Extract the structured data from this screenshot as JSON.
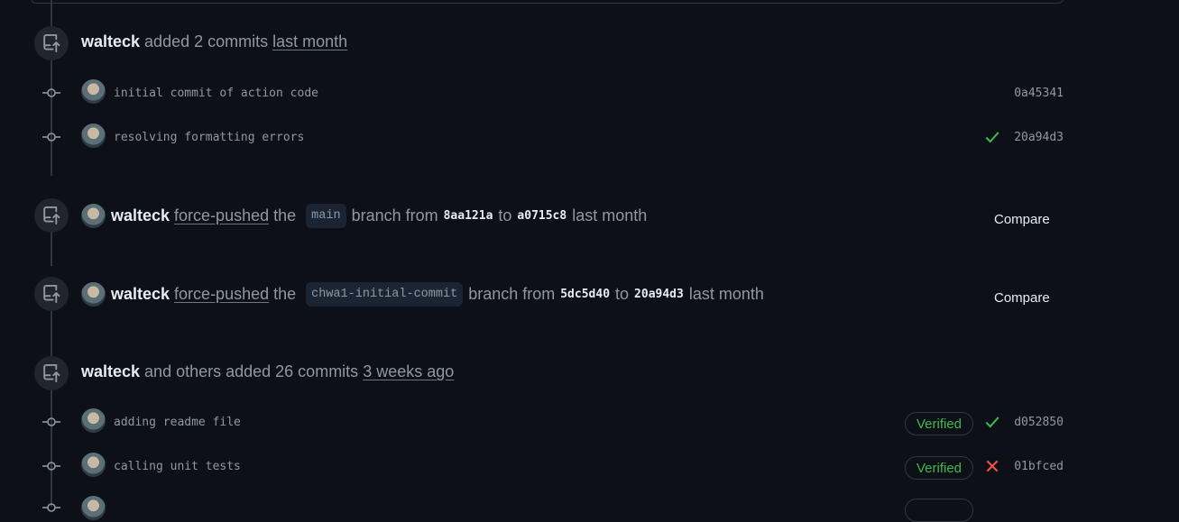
{
  "events": [
    {
      "author": "walteck",
      "pre": "added 2 commits",
      "time": "last month"
    },
    {
      "author": "walteck",
      "link": "force-pushed",
      "the": "the",
      "branch": "main",
      "mid": "branch from",
      "from": "8aa121a",
      "to_word": "to",
      "to": "a0715c8",
      "time": "last month",
      "compare": "Compare"
    },
    {
      "author": "walteck",
      "link": "force-pushed",
      "the": "the",
      "branch": "chwa1-initial-commit",
      "mid": "branch from",
      "from": "5dc5d40",
      "to_word": "to",
      "to": "20a94d3",
      "time": "last month",
      "compare": "Compare"
    },
    {
      "author": "walteck",
      "pre": "and others added 26 commits",
      "time": "3 weeks ago"
    }
  ],
  "commits_group1": [
    {
      "message": "initial commit of action code",
      "sha": "0a45341",
      "status": "none"
    },
    {
      "message": "resolving formatting errors",
      "sha": "20a94d3",
      "status": "success"
    }
  ],
  "commits_group2": [
    {
      "message": "adding readme file",
      "sha": "d052850",
      "status": "success",
      "verified": "Verified"
    },
    {
      "message": "calling unit tests",
      "sha": "01bfced",
      "status": "failure",
      "verified": "Verified"
    }
  ],
  "icons": {
    "event": "repo-push-icon",
    "commit": "git-commit-icon",
    "success": "check-icon",
    "failure": "x-icon"
  },
  "colors": {
    "success": "#3fb950",
    "failure": "#f85149",
    "background": "#0d1117"
  }
}
